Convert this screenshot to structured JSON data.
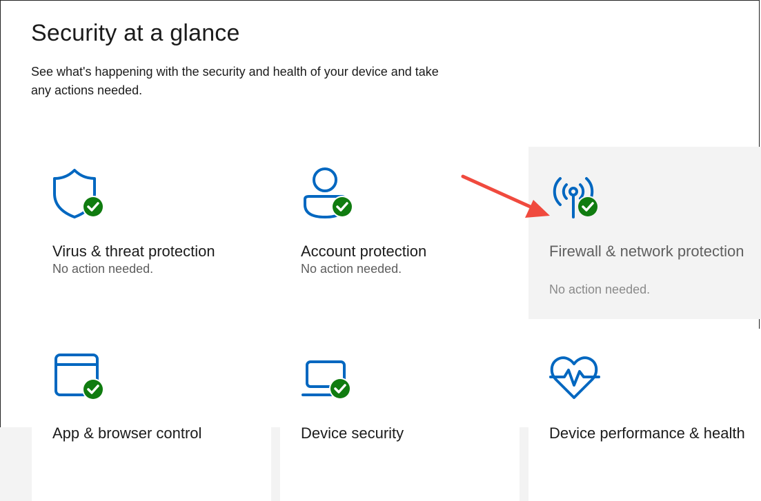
{
  "page": {
    "title": "Security at a glance",
    "description": "See what's happening with the security and health of your device and take any actions needed."
  },
  "colors": {
    "accent": "#0067c0",
    "ok": "#107c10",
    "annotation": "#f04a3e",
    "tile_hover": "#f3f3f3"
  },
  "tiles": [
    {
      "title": "Virus & threat protection",
      "status": "No action needed.",
      "icon": "shield-icon"
    },
    {
      "title": "Account protection",
      "status": "No action needed.",
      "icon": "person-icon"
    },
    {
      "title": "Firewall & network protection",
      "status": "No action needed.",
      "icon": "antenna-icon"
    },
    {
      "title": "App & browser control",
      "status": "",
      "icon": "app-window-icon"
    },
    {
      "title": "Device security",
      "status": "",
      "icon": "laptop-icon"
    },
    {
      "title": "Device performance & health",
      "status": "",
      "icon": "heart-pulse-icon"
    }
  ]
}
